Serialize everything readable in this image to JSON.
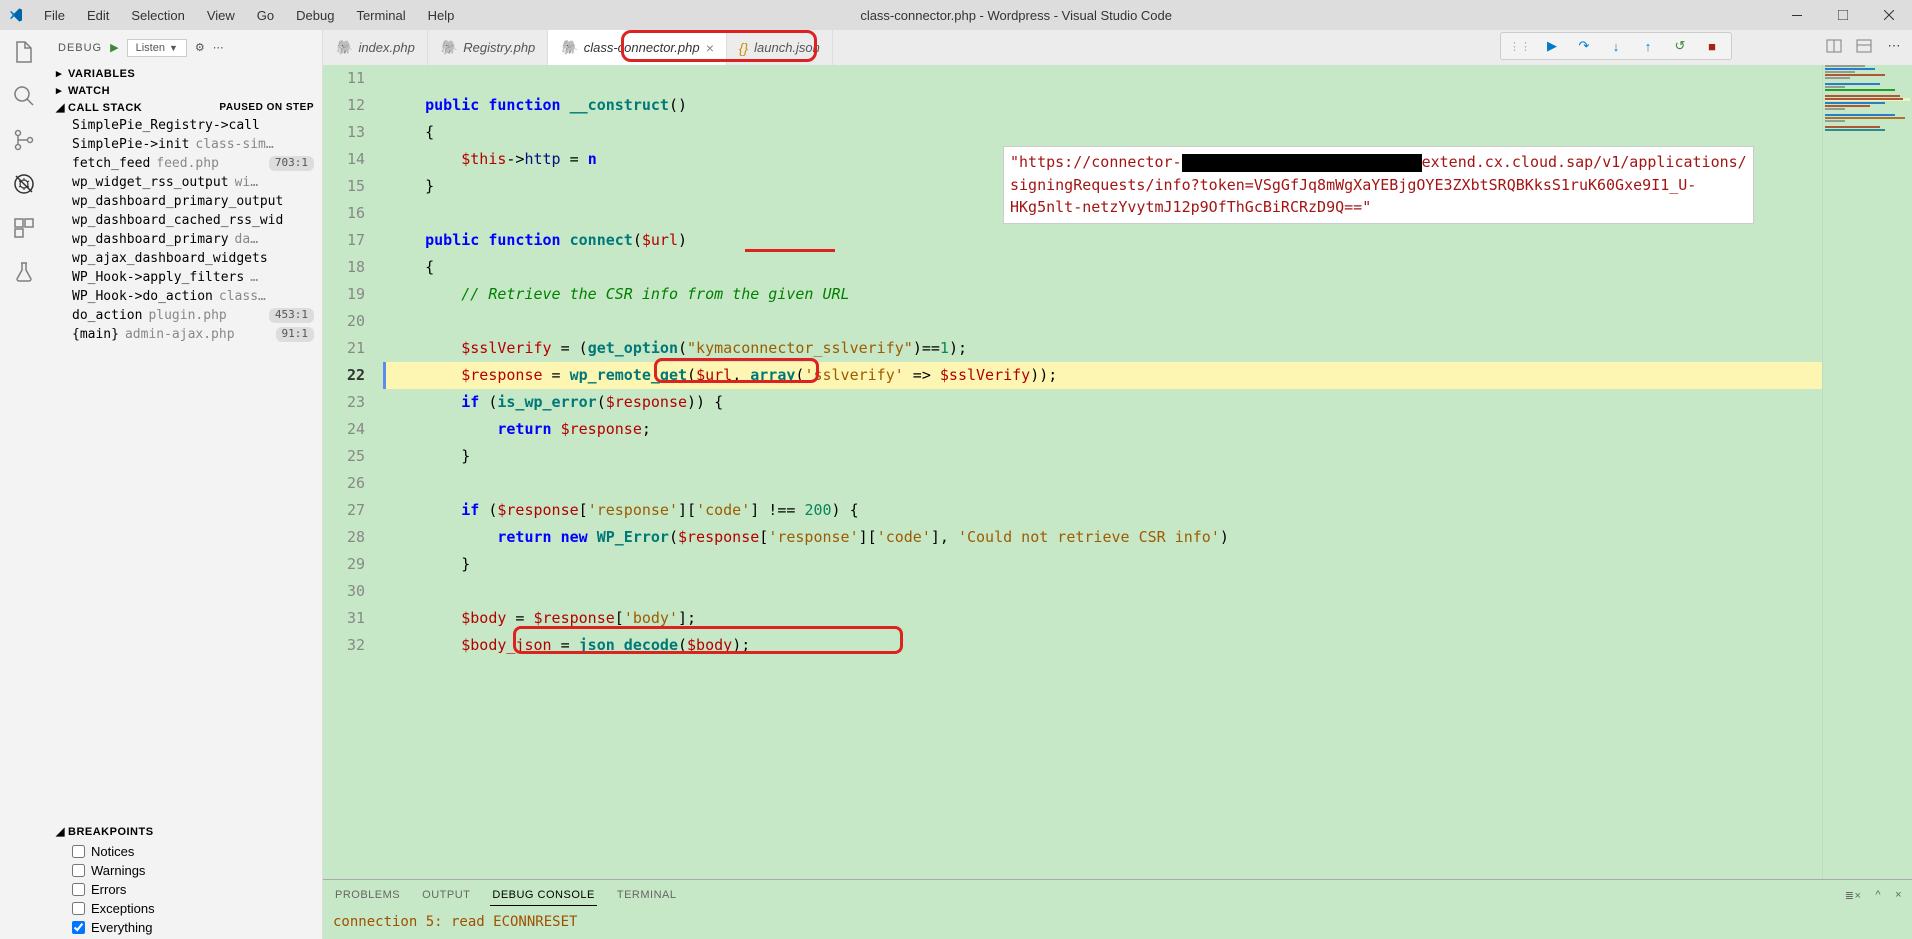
{
  "window": {
    "title": "class-connector.php - Wordpress - Visual Studio Code"
  },
  "menu": [
    "File",
    "Edit",
    "Selection",
    "View",
    "Go",
    "Debug",
    "Terminal",
    "Help"
  ],
  "debug": {
    "label": "DEBUG",
    "config": "Listen",
    "sections": {
      "variables": "VARIABLES",
      "watch": "WATCH",
      "callstack": "CALL STACK",
      "callstack_status": "PAUSED ON STEP",
      "breakpoints": "BREAKPOINTS"
    },
    "callstack": [
      {
        "func": "SimplePie_Registry->call",
        "file": "",
        "loc": ""
      },
      {
        "func": "SimplePie->init",
        "file": "class-sim…",
        "loc": ""
      },
      {
        "func": "fetch_feed",
        "file": "feed.php",
        "loc": "703:1"
      },
      {
        "func": "wp_widget_rss_output",
        "file": "wi…",
        "loc": ""
      },
      {
        "func": "wp_dashboard_primary_output",
        "file": "",
        "loc": ""
      },
      {
        "func": "wp_dashboard_cached_rss_wid",
        "file": "",
        "loc": ""
      },
      {
        "func": "wp_dashboard_primary",
        "file": "da…",
        "loc": ""
      },
      {
        "func": "wp_ajax_dashboard_widgets",
        "file": "",
        "loc": ""
      },
      {
        "func": "WP_Hook->apply_filters",
        "file": "…",
        "loc": ""
      },
      {
        "func": "WP_Hook->do_action",
        "file": "class…",
        "loc": ""
      },
      {
        "func": "do_action",
        "file": "plugin.php",
        "loc": "453:1"
      },
      {
        "func": "{main}",
        "file": "admin-ajax.php",
        "loc": "91:1"
      }
    ],
    "breakpoints": [
      {
        "label": "Notices",
        "checked": false
      },
      {
        "label": "Warnings",
        "checked": false
      },
      {
        "label": "Errors",
        "checked": false
      },
      {
        "label": "Exceptions",
        "checked": false
      },
      {
        "label": "Everything",
        "checked": true
      }
    ]
  },
  "tabs": [
    {
      "label": "index.php",
      "type": "php",
      "active": false
    },
    {
      "label": "Registry.php",
      "type": "php",
      "active": false
    },
    {
      "label": "class-connector.php",
      "type": "php",
      "active": true
    },
    {
      "label": "launch.json",
      "type": "json",
      "active": false
    }
  ],
  "tooltip": {
    "line1a": "\"https://connector-",
    "line1b": "extend.cx.cloud.sap/v1/applications/",
    "line2": "signingRequests/info?token=VSgGfJq8mWgXaYEBjgOYE3ZXbtSRQBKksS1ruK60Gxe9I1_U-",
    "line3": "HKg5nlt-netzYvytmJ12p9OfThGcBiRCRzD9Q==\""
  },
  "code": {
    "lines": [
      11,
      12,
      13,
      14,
      15,
      16,
      17,
      18,
      19,
      20,
      21,
      22,
      23,
      24,
      25,
      26,
      27,
      28,
      29,
      30,
      31,
      32
    ],
    "breakpoint_line": 21,
    "current_line": 22
  },
  "panel": {
    "tabs": [
      "PROBLEMS",
      "OUTPUT",
      "DEBUG CONSOLE",
      "TERMINAL"
    ],
    "active": "DEBUG CONSOLE",
    "content": "connection 5: read ECONNRESET"
  }
}
